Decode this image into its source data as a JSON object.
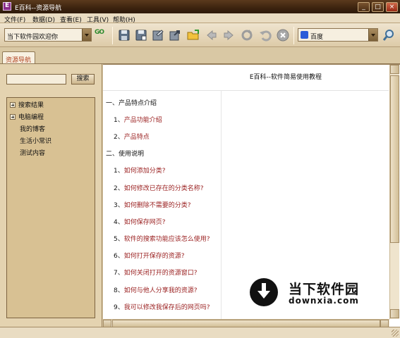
{
  "window": {
    "title": "E百科--资源导航",
    "buttons": [
      "_",
      "□",
      "×"
    ]
  },
  "menu": [
    {
      "label": "文件(F)"
    },
    {
      "label": "数据(D)"
    },
    {
      "label": "查看(E)"
    },
    {
      "label": "工具(V)"
    },
    {
      "label": "帮助(H)"
    }
  ],
  "toolbar": {
    "url_value": "当下软件园欢迎你",
    "go_label": "GO",
    "search_engine": "百度",
    "icons": [
      "save-icon",
      "save-as-icon",
      "open-icon",
      "export-icon",
      "folder-icon",
      "back-icon",
      "forward-icon",
      "refresh-icon",
      "undo-icon",
      "stop-icon",
      "search-icon"
    ]
  },
  "tab": {
    "label": "资源导航"
  },
  "sidebar": {
    "search_value": "",
    "search_button": "搜索",
    "tree": [
      {
        "label": "搜索结果",
        "expandable": true
      },
      {
        "label": "电脑编程",
        "expandable": true
      },
      {
        "label": "我的博客",
        "expandable": false
      },
      {
        "label": "生活小常识",
        "expandable": false
      },
      {
        "label": "测试内容",
        "expandable": false
      }
    ]
  },
  "doc": {
    "title": "E百科--软件简易使用教程",
    "section1": {
      "heading": "一、产品特点介绍",
      "items": [
        {
          "num": "1、",
          "text": "产品功能介绍"
        },
        {
          "num": "2、",
          "text": "产品特点"
        }
      ]
    },
    "section2": {
      "heading": "二、使用说明",
      "items": [
        {
          "num": "1、",
          "text": "如何添加分类?"
        },
        {
          "num": "2、",
          "text": "如何修改已存在的分类名称?"
        },
        {
          "num": "3、",
          "text": "如何删除不需要的分类?"
        },
        {
          "num": "4、",
          "text": "如何保存网页?"
        },
        {
          "num": "5、",
          "text": "软件的搜索功能应该怎么使用?"
        },
        {
          "num": "6、",
          "text": "如何打开保存的资源?"
        },
        {
          "num": "7、",
          "text": "如何关闭打开的资源窗口?"
        },
        {
          "num": "8、",
          "text": "如何与他人分享我的资源?"
        },
        {
          "num": "9、",
          "text": "我可以修改我保存后的网页吗?"
        }
      ]
    }
  },
  "watermark": {
    "cn": "当下软件园",
    "en": "downxia.com"
  },
  "colors": {
    "link": "#9b2222",
    "chrome": "#d9c8a4",
    "titlebar": "#3c230f"
  }
}
